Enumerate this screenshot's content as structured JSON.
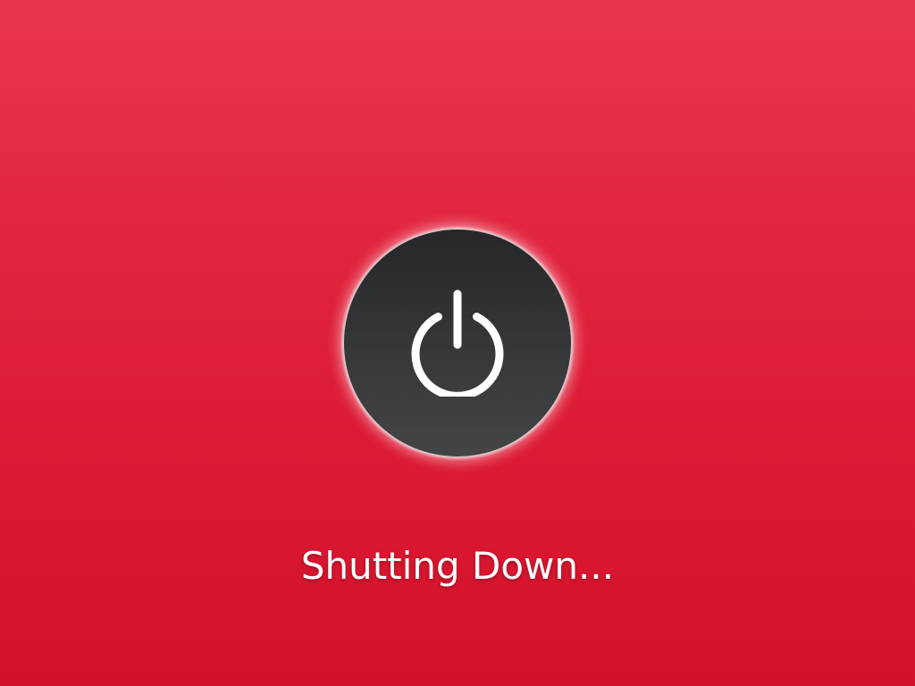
{
  "screen": {
    "status_text": "Shutting Down...",
    "power_icon": "power-icon"
  },
  "colors": {
    "background_top": "#e8354d",
    "background_bottom": "#d4112a",
    "circle_top": "#262729",
    "circle_bottom": "#434546",
    "icon": "#ffffff",
    "text": "#ffffff"
  }
}
